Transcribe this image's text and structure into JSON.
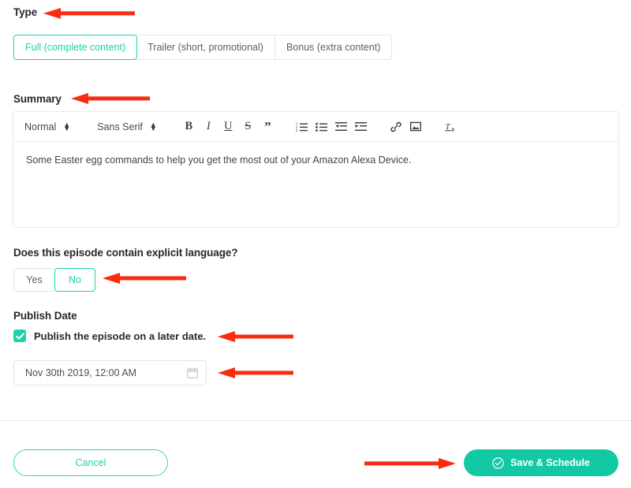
{
  "form": {
    "type_section": {
      "label": "Type",
      "options": [
        {
          "label": "Full (complete content)",
          "selected": true
        },
        {
          "label": "Trailer (short, promotional)",
          "selected": false
        },
        {
          "label": "Bonus (extra content)",
          "selected": false
        }
      ]
    },
    "summary_section": {
      "label": "Summary",
      "toolbar": {
        "block_format": "Normal",
        "font_family": "Sans Serif",
        "buttons": [
          "bold-icon",
          "italic-icon",
          "underline-icon",
          "strikethrough-icon",
          "blockquote-icon",
          "ordered-list-icon",
          "bullet-list-icon",
          "outdent-icon",
          "indent-icon",
          "link-icon",
          "image-icon",
          "clear-formatting-icon"
        ]
      },
      "body_text": "Some Easter egg commands to help you get the most out of your Amazon Alexa Device."
    },
    "explicit_section": {
      "label": "Does this episode contain explicit language?",
      "options": [
        {
          "label": "Yes",
          "selected": false
        },
        {
          "label": "No",
          "selected": true
        }
      ]
    },
    "publish_section": {
      "label": "Publish Date",
      "checkbox_label": "Publish the episode on a later date.",
      "checkbox_checked": true,
      "date_value": "Nov 30th 2019, 12:00 AM",
      "calendar_icon": "calendar-icon"
    }
  },
  "footer": {
    "cancel_label": "Cancel",
    "save_label": "Save & Schedule",
    "save_icon": "check-circle-icon"
  },
  "colors": {
    "accent_teal": "#19d3ae",
    "save_button_bg": "#12c9a4",
    "annotation_red": "#fa2b0f",
    "border_gray": "#e3e5e8",
    "text_dark": "#26282b"
  },
  "annotations": [
    {
      "name": "arrow-to-type-label",
      "direction": "left"
    },
    {
      "name": "arrow-to-summary-label",
      "direction": "left"
    },
    {
      "name": "arrow-to-explicit-no-option",
      "direction": "left"
    },
    {
      "name": "arrow-to-publish-later-checkbox",
      "direction": "left"
    },
    {
      "name": "arrow-to-date-field",
      "direction": "left"
    },
    {
      "name": "arrow-to-save-schedule-button",
      "direction": "right"
    }
  ]
}
